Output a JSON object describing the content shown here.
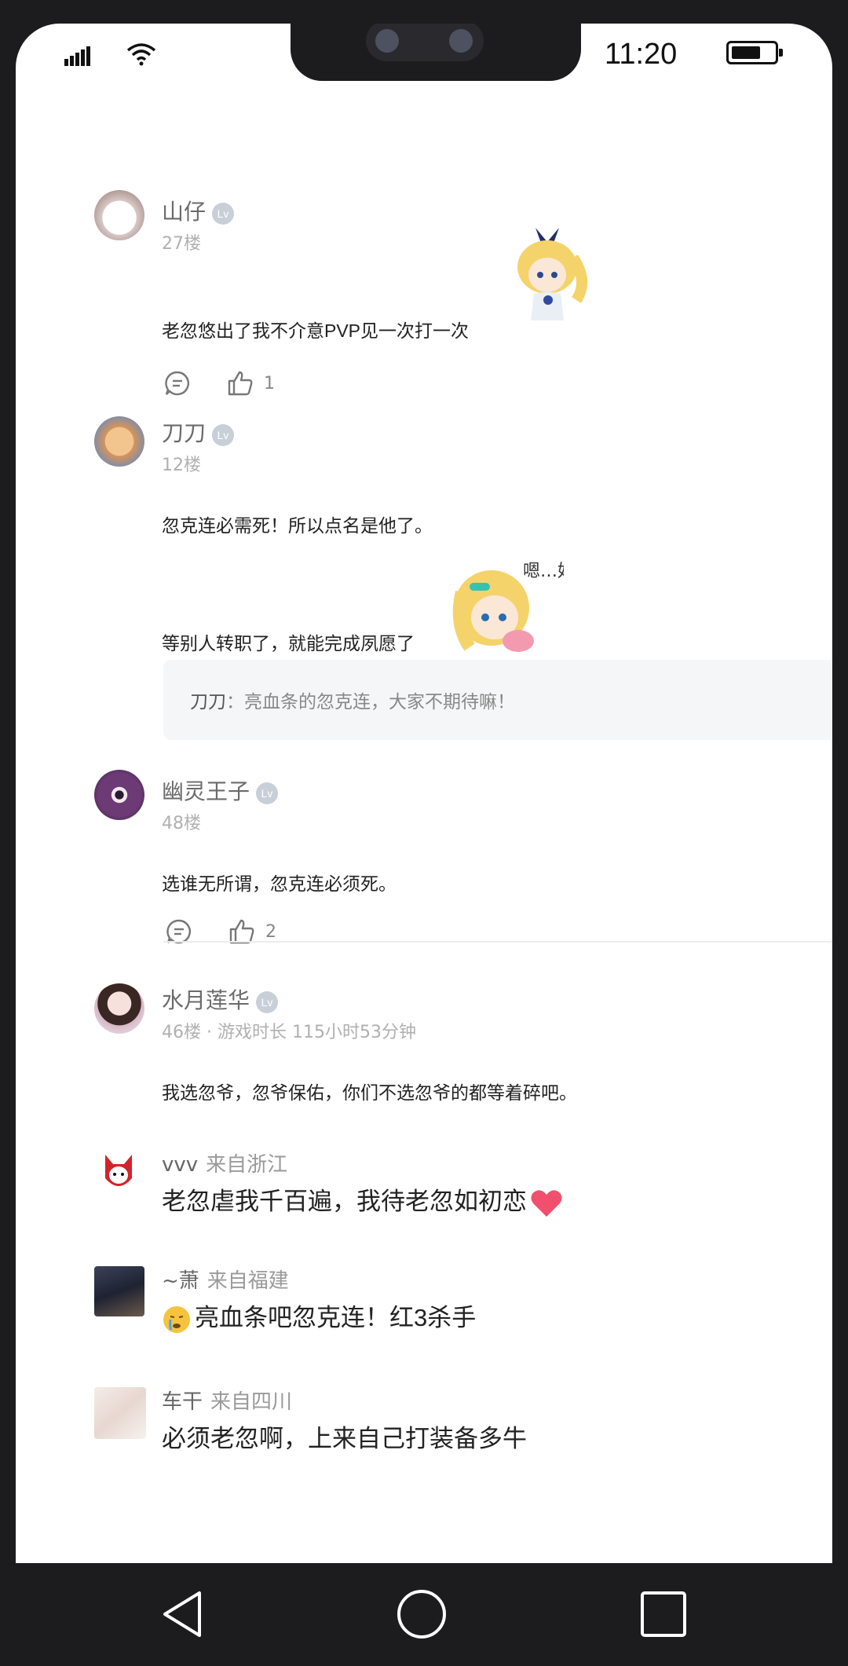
{
  "status_bar": {
    "time": "11:20"
  },
  "comments": [
    {
      "user": "山仔",
      "level": "Lv",
      "floor": "27楼",
      "text": "老忽悠出了我不介意PVP见一次打一次",
      "likes": "1"
    },
    {
      "user": "刀刀",
      "level": "Lv",
      "floor": "12楼",
      "text_line1": "忽克连必需死！所以点名是他了。",
      "text_line2": "等别人转职了，就能完成夙愿了",
      "sticker_text": "嗯…好累呀",
      "quote": {
        "author": "刀刀",
        "separator": "：",
        "text": "亮血条的忽克连，大家不期待嘛！"
      }
    },
    {
      "user": "幽灵王子",
      "level": "Lv",
      "floor": "48楼",
      "text": "选谁无所谓，忽克连必须死。",
      "likes": "2"
    },
    {
      "user": "水月莲华",
      "level": "Lv",
      "floor": "46楼 · 游戏时长 115小时53分钟",
      "text": "我选忽爷，忽爷保佑，你们不选忽爷的都等着碎吧。"
    }
  ],
  "replies": [
    {
      "user": "vvv",
      "location": "来自浙江",
      "text": "老忽虐我千百遍，我待老忽如初恋"
    },
    {
      "user": "~萧",
      "location": "来自福建",
      "text": "亮血条吧忽克连！红3杀手"
    },
    {
      "user": "车干",
      "location": "来自四川",
      "text": "必须老忽啊，上来自己打装备多牛"
    }
  ],
  "icons": {
    "reply": "comment-bubble-icon",
    "like": "thumbs-up-icon",
    "nav_back": "triangle-back-icon",
    "nav_home": "circle-home-icon",
    "nav_recent": "square-recent-icon"
  }
}
